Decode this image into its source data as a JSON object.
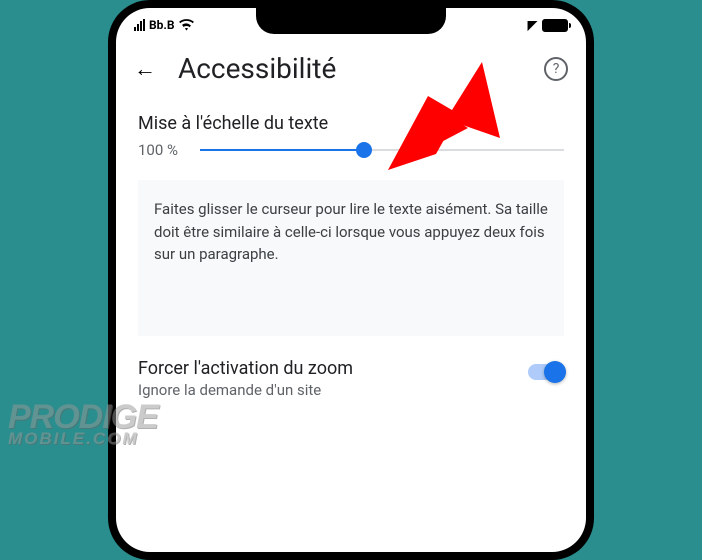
{
  "status": {
    "carrier": "Bb.B"
  },
  "header": {
    "title": "Accessibilité"
  },
  "text_scaling": {
    "label": "Mise à l'échelle du texte",
    "percent": "100 %",
    "slider_fill_percent": 45,
    "preview": "Faites glisser le curseur pour lire le texte aisément. Sa taille doit être similaire à celle-ci lorsque vous appuyez deux fois sur un paragraphe."
  },
  "force_zoom": {
    "title": "Forcer l'activation du zoom",
    "subtitle": "Ignore la demande d'un site",
    "enabled": true
  },
  "watermark": {
    "line1": "PRODIGE",
    "line2": "MOBILE.COM"
  },
  "colors": {
    "accent": "#1a73e8",
    "arrow": "#ff0000"
  }
}
